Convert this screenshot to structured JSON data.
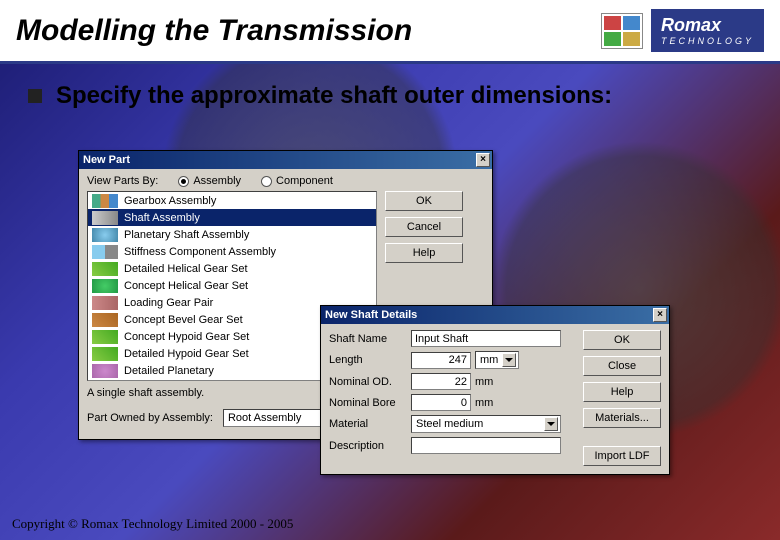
{
  "header": {
    "title": "Modelling the Transmission",
    "brand_name": "Romax",
    "brand_sub": "TECHNOLOGY"
  },
  "subtitle": "Specify the approximate shaft outer dimensions:",
  "dialog1": {
    "title": "New Part",
    "view_label": "View Parts By:",
    "radio_assembly": "Assembly",
    "radio_component": "Component",
    "items": [
      "Gearbox Assembly",
      "Shaft Assembly",
      "Planetary Shaft Assembly",
      "Stiffness Component Assembly",
      "Detailed Helical Gear Set",
      "Concept Helical Gear Set",
      "Loading Gear Pair",
      "Concept Bevel Gear Set",
      "Concept Hypoid Gear Set",
      "Detailed Hypoid Gear Set",
      "Detailed Planetary"
    ],
    "ok": "OK",
    "cancel": "Cancel",
    "help": "Help",
    "desc": "A single shaft assembly.",
    "owned_label": "Part Owned by Assembly:",
    "owned_value": "Root Assembly"
  },
  "dialog2": {
    "title": "New Shaft Details",
    "fields": {
      "name_label": "Shaft Name",
      "name_value": "Input Shaft",
      "length_label": "Length",
      "length_value": "247",
      "length_unit": "mm",
      "od_label": "Nominal OD.",
      "od_value": "22",
      "od_unit": "mm",
      "bore_label": "Nominal Bore",
      "bore_value": "0",
      "bore_unit": "mm",
      "material_label": "Material",
      "material_value": "Steel medium",
      "desc_label": "Description"
    },
    "ok": "OK",
    "close": "Close",
    "help": "Help",
    "materials": "Materials...",
    "import": "Import LDF"
  },
  "footer": "Copyright © Romax Technology Limited 2000 - 2005"
}
